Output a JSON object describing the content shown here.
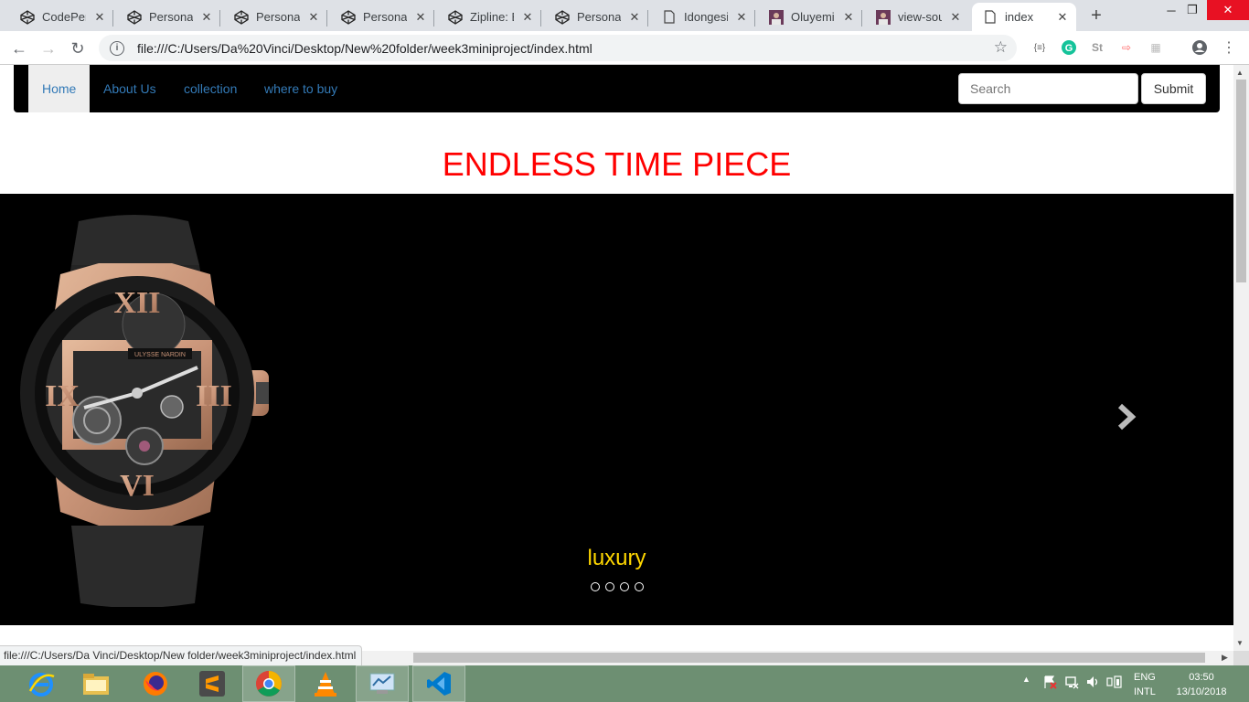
{
  "browser": {
    "tabs": [
      {
        "title": "CodePen",
        "icon": "codepen-icon"
      },
      {
        "title": "Personal P",
        "icon": "codepen-icon"
      },
      {
        "title": "Personal P",
        "icon": "codepen-icon"
      },
      {
        "title": "Personal P",
        "icon": "codepen-icon"
      },
      {
        "title": "Zipline: Bu",
        "icon": "codepen-icon"
      },
      {
        "title": "Personal P",
        "icon": "codepen-icon"
      },
      {
        "title": "Idongesit",
        "icon": "document-icon"
      },
      {
        "title": "Oluyemi -",
        "icon": "avatar-icon"
      },
      {
        "title": "view-sour",
        "icon": "avatar-icon"
      },
      {
        "title": "index",
        "icon": "document-icon"
      }
    ],
    "active_tab_index": 9,
    "address": "file:///C:/Users/Da%20Vinci/Desktop/New%20folder/week3miniproject/index.html",
    "status_url": "file:///C:/Users/Da Vinci/Desktop/New folder/week3miniproject/index.html"
  },
  "page": {
    "nav": {
      "items": [
        "Home",
        "About Us",
        "collection",
        "where to buy"
      ],
      "active": "Home",
      "search_placeholder": "Search",
      "submit_label": "Submit"
    },
    "heading": "ENDLESS TIME PIECE",
    "carousel": {
      "caption": "luxury",
      "slide_count": 4,
      "watch_brand": "ULYSSE NARDIN"
    }
  },
  "taskbar": {
    "apps": [
      "internet-explorer-icon",
      "file-explorer-icon",
      "firefox-icon",
      "sublime-text-icon",
      "chrome-icon",
      "vlc-icon",
      "control-panel-icon",
      "vscode-icon"
    ],
    "language": [
      "ENG",
      "INTL"
    ],
    "time": "03:50",
    "date": "13/10/2018"
  },
  "colors": {
    "heading": "#ff0000",
    "caption": "#ffd700",
    "nav_link": "#337ab7",
    "taskbar": "#6d8f72"
  }
}
